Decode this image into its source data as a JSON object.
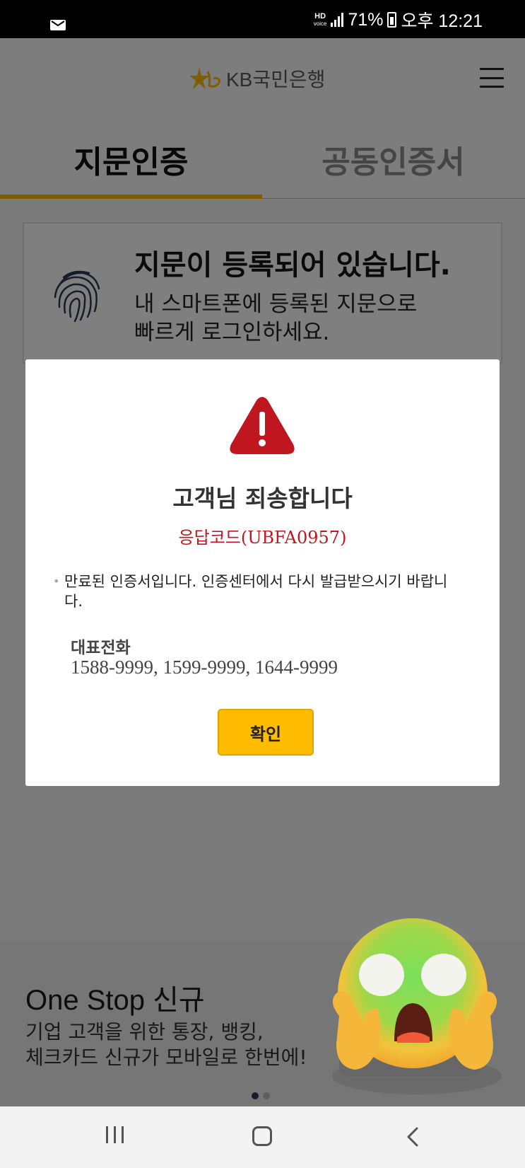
{
  "status_bar": {
    "hd_label": "HD\nvoice",
    "battery": "71%",
    "time": "오후 12:21",
    "left_icon": "mail-notification-icon"
  },
  "header": {
    "logo_text": "KB국민은행",
    "logo_icon": "kb-star-logo-icon",
    "menu_icon": "hamburger-menu-icon",
    "brand_color": "#ffbc00"
  },
  "tabs": [
    {
      "label": "지문인증",
      "active": true
    },
    {
      "label": "공동인증서",
      "active": false
    }
  ],
  "fingerprint_card": {
    "icon": "fingerprint-icon",
    "title": "지문이 등록되어 있습니다.",
    "desc_line1": "내 스마트폰에 등록된 지문으로",
    "desc_line2": "빠르게 로그인하세요."
  },
  "dialog": {
    "icon": "warning-triangle-icon",
    "icon_color": "#c0161f",
    "title": "고객님 죄송합니다",
    "code": "응답코드(UBFA0957)",
    "message": "만료된 인증서입니다. 인증센터에서 다시 발급받으시기 바랍니다.",
    "phone_label": "대표전화",
    "phone_numbers": "1588-9999, 1599-9999, 1644-9999",
    "confirm_label": "확인"
  },
  "banner": {
    "title": "One Stop 신규",
    "desc_line1": "기업 고객을 위한 통장, 뱅킹,",
    "desc_line2": "체크카드 신규가 모바일로 한번에!",
    "pages": 2,
    "active_page": 1
  },
  "sticker": "screaming-face-emoji",
  "nav_bar": {
    "recent_icon": "recent-apps-icon",
    "home_icon": "home-icon",
    "back_icon": "back-icon"
  }
}
